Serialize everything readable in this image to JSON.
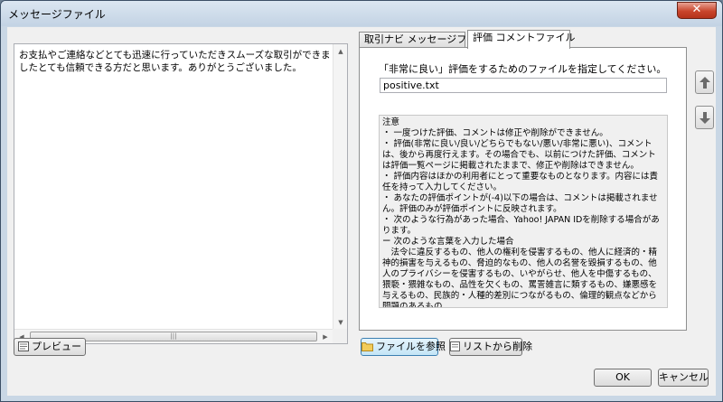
{
  "window": {
    "title": "メッセージファイル",
    "close_label": "✕"
  },
  "memo": {
    "text": "お支払やご連絡などとても迅速に行っていただきスムーズな取引ができましたとても信頼できる方だと思います。ありがとうございました。"
  },
  "tabs": [
    {
      "label": "取引ナビ メッセージファイル",
      "active": false
    },
    {
      "label": "評価 コメントファイル",
      "active": true
    }
  ],
  "panel": {
    "instruction": "「非常に良い」評価をするためのファイルを指定してください。",
    "file_value": "positive.txt",
    "notes": "注意\n・ 一度つけた評価、コメントは修正や削除ができません。\n・ 評価(非常に良い/良い/どちらでもない/悪い/非常に悪い)、コメントは、後から再度行えます。その場合でも、以前につけた評価、コメントは評価一覧ページに掲載されたままで、修正や削除はできません。\n・ 評価内容はほかの利用者にとって重要なものとなります。内容には責任を持って入力してください。\n・ あなたの評価ポイントが(-4)以下の場合は、コメントは掲載されません。評価のみが評価ポイントに反映されます。\n・ 次のような行為があった場合、Yahoo! JAPAN IDを削除する場合があります。\nー 次のような言葉を入力した場合\n　法令に違反するもの、他人の権利を侵害するもの、他人に経済的・精神的損害を与えるもの、脅迫的なもの、他人の名誉を毀損するもの、他人のプライバシーを侵害するもの、いやがらせ、他人を中傷するもの、猥褻・猥雑なもの、品性を欠くもの、罵詈雑言に類するもの、嫌悪感を与えるもの、民族的・人種的差別につながるもの、倫理的観点などから問題のあるもの\n\nー 住所、氏名、メールアドレス、電話番号、クレジットカード番号などの個人情報を掲載した場合"
  },
  "buttons": {
    "preview": "プレビュー",
    "browse": "ファイルを参照",
    "remove": "リストから削除",
    "ok": "OK",
    "cancel": "キャンセル"
  },
  "scroll": {
    "thumb_grip": "|||"
  },
  "icons": {
    "up": "arrow-up-icon",
    "down": "arrow-down-icon",
    "folder": "folder-icon",
    "preview": "preview-icon",
    "list": "list-remove-icon"
  }
}
